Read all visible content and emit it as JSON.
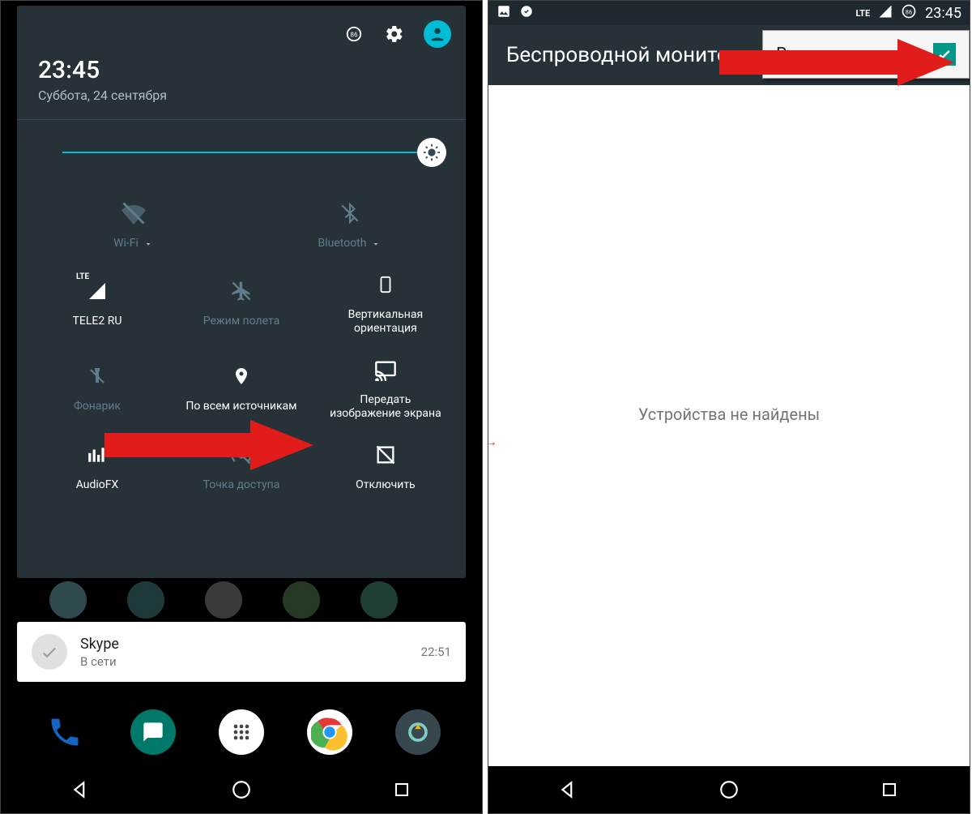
{
  "left": {
    "time": "23:45",
    "date": "Суббота, 24 сентября",
    "badge": "86",
    "tiles": {
      "wifi": "Wi-Fi",
      "bluetooth": "Bluetooth",
      "signal_provider": "TELE2 RU",
      "signal_net": "LTE",
      "airplane": "Режим полета",
      "rotation": "Вертикальная\nориентация",
      "flashlight": "Фонарик",
      "location": "По всем источникам",
      "cast": "Передать\nизображение экрана",
      "audiofx": "AudioFX",
      "hotspot": "Точка доступа",
      "disconnect": "Отключить"
    },
    "notification": {
      "app": "Skype",
      "status": "В сети",
      "time": "22:51"
    }
  },
  "right": {
    "status": {
      "net": "LTE",
      "badge": "86",
      "time": "23:45"
    },
    "title": "Беспроводной монитор",
    "enable_label": "Включить",
    "empty": "Устройства не найдены"
  }
}
